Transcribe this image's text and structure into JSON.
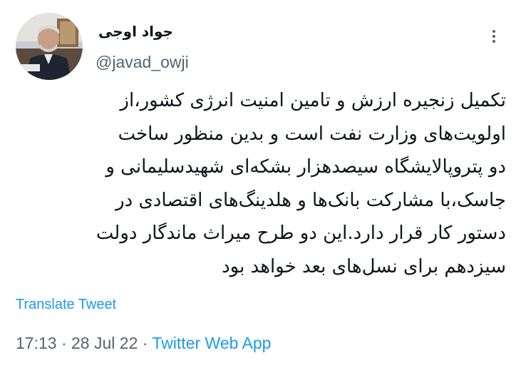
{
  "author": {
    "name": "جواد اوجی",
    "handle": "@javad_owji"
  },
  "tweet": {
    "lines": [
      "تکمیل زنجیره ارزش و تامین امنیت انرژی کشور،از",
      "اولویت‌های وزارت نفت است و بدین منظور ساخت",
      "دو پتروپالایشگاه سیصدهزار بشکه‌ای شهیدسلیمانی و",
      "جاسک،با مشارکت بانک‌ها و هلدینگ‌های اقتصادی در",
      "دستور کار قرار دارد.این دو طرح میراث ماندگار دولت",
      "سیزدهم برای نسل‌های بعد خواهد بود"
    ]
  },
  "actions": {
    "translate_label": "Translate Tweet"
  },
  "meta": {
    "time": "17:13",
    "separator_1": "·",
    "date": "28 Jul 22",
    "separator_2": "·",
    "source": "Twitter Web App"
  },
  "icons": {
    "more": "more-dots-icon",
    "avatar": "profile-photo"
  },
  "colors": {
    "link": "#1d9bf0",
    "secondary_text": "#536471",
    "primary_text": "#0f1419"
  }
}
